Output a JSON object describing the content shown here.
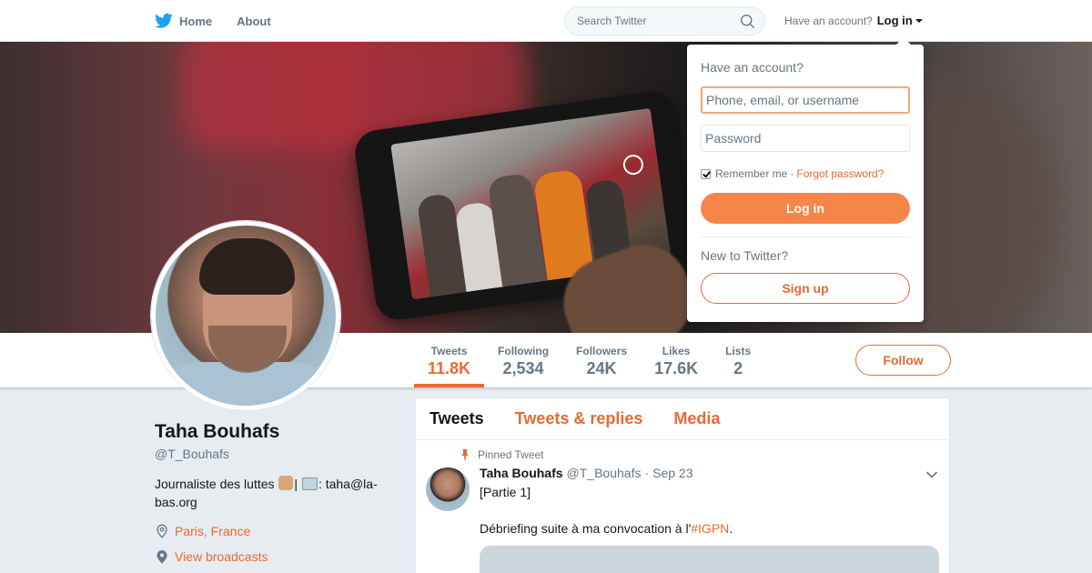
{
  "nav": {
    "home_label": "Home",
    "about_label": "About",
    "search_placeholder": "Search Twitter",
    "have_account": "Have an account?",
    "login_label": "Log in"
  },
  "profile": {
    "name": "Taha Bouhafs",
    "handle": "@T_Bouhafs",
    "bio_before": "Journaliste des luttes ",
    "bio_middle": "| ",
    "bio_after": ": taha@la-bas.org",
    "location": "Paris, France",
    "broadcasts": "View broadcasts",
    "follow_label": "Follow"
  },
  "stats": [
    {
      "label": "Tweets",
      "value": "11.8K",
      "active": true
    },
    {
      "label": "Following",
      "value": "2,534"
    },
    {
      "label": "Followers",
      "value": "24K"
    },
    {
      "label": "Likes",
      "value": "17.6K"
    },
    {
      "label": "Lists",
      "value": "2"
    }
  ],
  "timeline": {
    "tabs": [
      "Tweets",
      "Tweets & replies",
      "Media"
    ],
    "pinned_label": "Pinned Tweet",
    "tweet": {
      "name": "Taha Bouhafs",
      "handle": "@T_Bouhafs",
      "dot": "·",
      "date": "Sep 23",
      "line1": "[Partie 1]",
      "line2_before": "Débriefing suite à ma convocation à l'",
      "hashtag": "#IGPN",
      "line2_after": "."
    }
  },
  "login_dropdown": {
    "title": "Have an account?",
    "username_placeholder": "Phone, email, or username",
    "password_placeholder": "Password",
    "remember_label": "Remember me",
    "separator": "·",
    "forgot_label": "Forgot password?",
    "login_button": "Log in",
    "new_label": "New to Twitter?",
    "signup_button": "Sign up"
  },
  "colors": {
    "accent": "#e86a33",
    "brand": "#1da1f2"
  }
}
